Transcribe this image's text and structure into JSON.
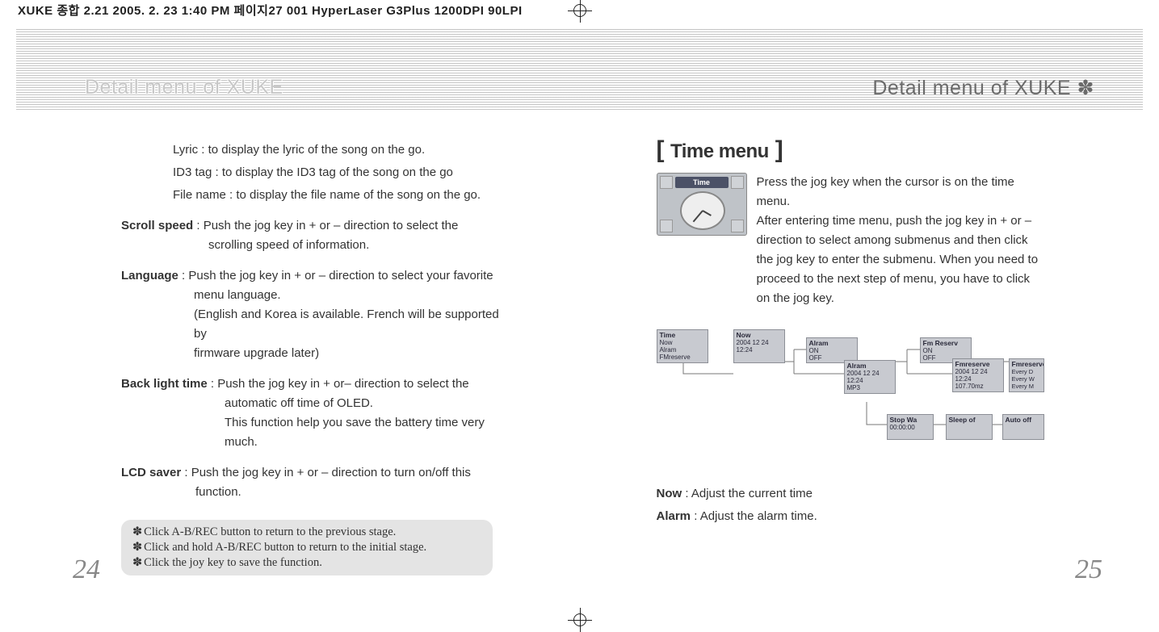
{
  "file_header": "XUKE 종합 2.21  2005. 2. 23 1:40 PM  페이지27   001 HyperLaser G3Plus 1200DPI 90LPI",
  "heading_left": "Detail menu of XUKE",
  "heading_right": "Detail menu of XUKE",
  "heading_star": "✽",
  "left": {
    "definitions": {
      "lyric": "Lyric : to display the lyric of the song on the go.",
      "id3": "ID3 tag : to display the ID3 tag of the song on the go",
      "filename": "File name : to display the file name of the song on the go."
    },
    "scroll": {
      "label": "Scroll speed",
      "text": " : Push the jog key in + or – direction to select the",
      "cont1": "scrolling speed of information."
    },
    "language": {
      "label": "Language",
      "text": " : Push the jog key in + or – direction to select your favorite",
      "cont1": "menu language.",
      "cont2": " (English and Korea is available. French will be supported by",
      "cont3": "firmware upgrade later)"
    },
    "backlight": {
      "label": "Back light time",
      "text": " : Push the jog key in + or– direction to select the",
      "cont1": "automatic off time of OLED.",
      "cont2": "This function help you save the battery time very",
      "cont3": "much."
    },
    "lcd": {
      "label": "LCD saver",
      "text": " : Push the jog key in + or – direction to turn on/off this",
      "cont1": "function."
    },
    "tips": {
      "t1": "Click A-B/REC button to return to the previous stage.",
      "t2": "Click and hold A-B/REC button to return to the initial stage.",
      "t3": "Click the joy key to save the function."
    },
    "page_num": "24"
  },
  "right": {
    "title": "Time menu",
    "screen": {
      "banner": "Time"
    },
    "intro": "Press the jog key when the cursor is on the time menu.\nAfter entering time menu, push the jog key in + or – direction to select among submenus and then click the jog key to enter the submenu. When you need to proceed to the next step of menu, you have to click on the jog key.",
    "nodes": {
      "root": {
        "title": "Time",
        "lines": "Now\nAlram\nFMreserve"
      },
      "now": {
        "title": "Now",
        "lines": "2004 12 24\n12:24"
      },
      "alram1": {
        "title": "Alram",
        "lines": "ON\nOFF"
      },
      "alram2": {
        "title": "Alram",
        "lines": "2004 12 24\n12:24\nMP3"
      },
      "fmres": {
        "title": "Fm Reserv",
        "lines": "ON\nOFF"
      },
      "fmres1": {
        "title": "Fmreserve",
        "lines": "2004 12 24\n12:24\n107.70mz"
      },
      "fmres2": {
        "title": "Fmreserve",
        "lines": "Every D\nEvery W\nEvery M"
      },
      "stop": {
        "title": "Stop Wa",
        "lines": "00:00:00"
      },
      "sleep": {
        "title": "Sleep of",
        "lines": ""
      },
      "auto": {
        "title": "Auto off",
        "lines": ""
      }
    },
    "defs": {
      "now": {
        "label": "Now",
        "text": " : Adjust the current time"
      },
      "alarm": {
        "label": "Alarm",
        "text": " : Adjust the alarm time."
      }
    },
    "page_num": "25"
  },
  "bracket_l": "[",
  "bracket_r": "]",
  "star": "✽"
}
